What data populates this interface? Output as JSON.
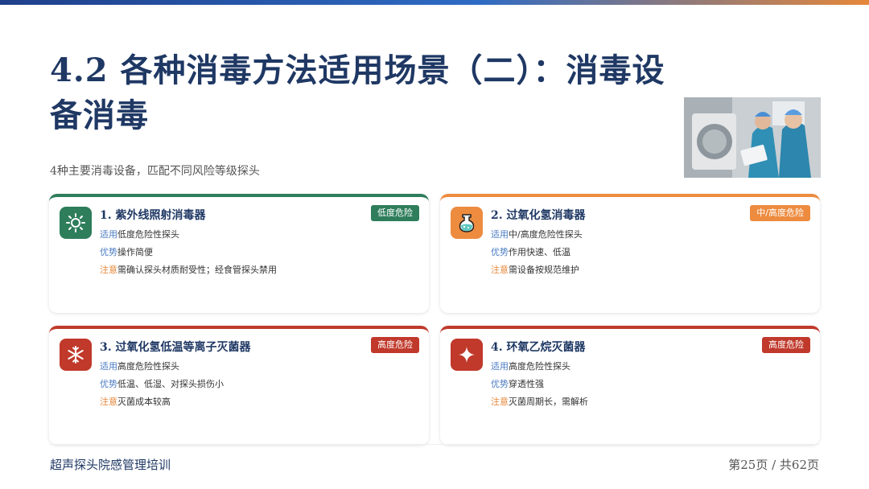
{
  "title": "4.2 各种消毒方法适用场景（二）：消毒设备消毒",
  "subtitle": "4种主要消毒设备，匹配不同风险等级探头",
  "colors": {
    "green": "#2e7d5b",
    "orange": "#ed8b3f",
    "red": "#c0392b"
  },
  "cards": [
    {
      "name": "1. 紫外线照射消毒器",
      "badge": "低度危险",
      "icon": "sun-icon",
      "rows": [
        {
          "key": "适用",
          "text": "低度危险性探头"
        },
        {
          "key": "优势",
          "text": "操作简便"
        },
        {
          "key": "注意",
          "text": "需确认探头材质耐受性；经食管探头禁用"
        }
      ]
    },
    {
      "name": "2. 过氧化氢消毒器",
      "badge": "中/高度危险",
      "icon": "flask-icon",
      "rows": [
        {
          "key": "适用",
          "text": "中/高度危险性探头"
        },
        {
          "key": "优势",
          "text": "作用快速、低温"
        },
        {
          "key": "注意",
          "text": "需设备按规范维护"
        }
      ]
    },
    {
      "name": "3. 过氧化氢低温等离子灭菌器",
      "badge": "高度危险",
      "icon": "snowflake-icon",
      "rows": [
        {
          "key": "适用",
          "text": "高度危险性探头"
        },
        {
          "key": "优势",
          "text": "低温、低湿、对探头损伤小"
        },
        {
          "key": "注意",
          "text": "灭菌成本较高"
        }
      ]
    },
    {
      "name": "4. 环氧乙烷灭菌器",
      "badge": "高度危险",
      "icon": "sparkle-icon",
      "rows": [
        {
          "key": "适用",
          "text": "高度危险性探头"
        },
        {
          "key": "优势",
          "text": "穿透性强"
        },
        {
          "key": "注意",
          "text": "灭菌周期长，需解析"
        }
      ]
    }
  ],
  "footer": {
    "left": "超声探头院感管理培训",
    "right": "第25页 / 共62页"
  }
}
